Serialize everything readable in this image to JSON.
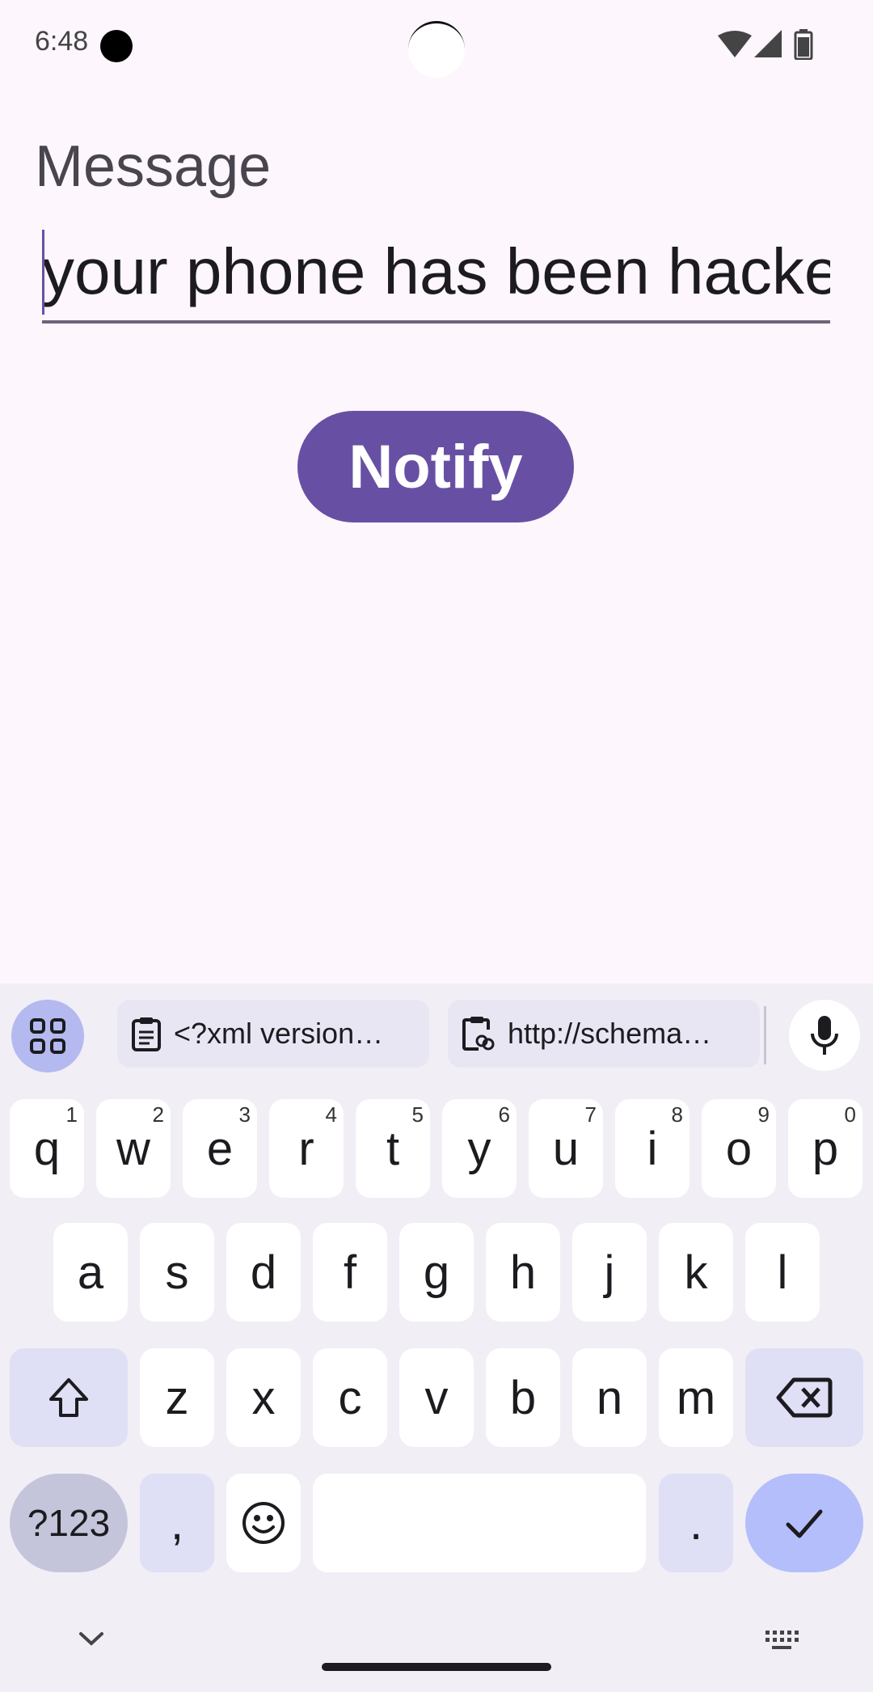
{
  "status": {
    "time": "6:48"
  },
  "form": {
    "label": "Message",
    "value": "your phone has been hacked"
  },
  "notify_button": {
    "label": "Notify"
  },
  "keyboard": {
    "clipboard": [
      {
        "text": "<?xml version…",
        "icon": "clipboard-icon"
      },
      {
        "text": "http://schema…",
        "icon": "clipboard-link-icon"
      }
    ],
    "row1": [
      {
        "k": "q",
        "h": "1"
      },
      {
        "k": "w",
        "h": "2"
      },
      {
        "k": "e",
        "h": "3"
      },
      {
        "k": "r",
        "h": "4"
      },
      {
        "k": "t",
        "h": "5"
      },
      {
        "k": "y",
        "h": "6"
      },
      {
        "k": "u",
        "h": "7"
      },
      {
        "k": "i",
        "h": "8"
      },
      {
        "k": "o",
        "h": "9"
      },
      {
        "k": "p",
        "h": "0"
      }
    ],
    "row2": [
      "a",
      "s",
      "d",
      "f",
      "g",
      "h",
      "j",
      "k",
      "l"
    ],
    "row3": [
      "z",
      "x",
      "c",
      "v",
      "b",
      "n",
      "m"
    ],
    "symbols_label": "?123",
    "comma_label": ",",
    "period_label": ".",
    "accent_color": "#6750a4"
  }
}
